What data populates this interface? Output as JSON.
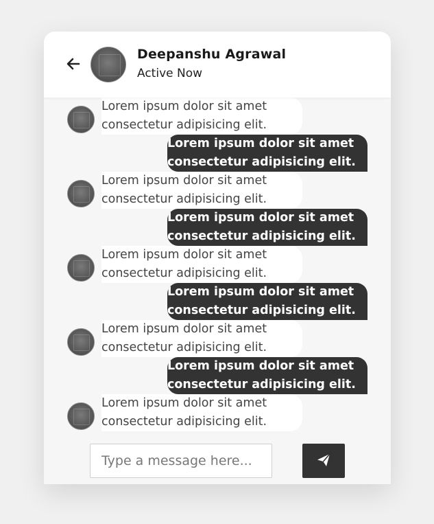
{
  "header": {
    "user_name": "Deepanshu Agrawal",
    "status": "Active Now"
  },
  "messages": [
    {
      "direction": "incoming",
      "lines": [
        "Lorem ipsum dolor sit amet",
        "consectetur adipisicing elit."
      ]
    },
    {
      "direction": "outgoing",
      "lines": [
        "Lorem ipsum dolor sit amet",
        "consectetur adipisicing elit."
      ]
    },
    {
      "direction": "incoming",
      "lines": [
        "Lorem ipsum dolor sit amet",
        "consectetur adipisicing elit."
      ]
    },
    {
      "direction": "outgoing",
      "lines": [
        "Lorem ipsum dolor sit amet",
        "consectetur adipisicing elit."
      ]
    },
    {
      "direction": "incoming",
      "lines": [
        "Lorem ipsum dolor sit amet",
        "consectetur adipisicing elit."
      ]
    },
    {
      "direction": "outgoing",
      "lines": [
        "Lorem ipsum dolor sit amet",
        "consectetur adipisicing elit."
      ]
    },
    {
      "direction": "incoming",
      "lines": [
        "Lorem ipsum dolor sit amet",
        "consectetur adipisicing elit."
      ]
    },
    {
      "direction": "outgoing",
      "lines": [
        "Lorem ipsum dolor sit amet",
        "consectetur adipisicing elit."
      ]
    },
    {
      "direction": "incoming",
      "lines": [
        "Lorem ipsum dolor sit amet",
        "consectetur adipisicing elit."
      ]
    }
  ],
  "footer": {
    "input_value": "",
    "input_placeholder": "Type a message here..."
  },
  "icons": {
    "back": "arrow-left-icon",
    "send": "paper-plane-icon"
  },
  "colors": {
    "outgoing_bubble": "#333333",
    "incoming_bubble": "#ffffff",
    "send_button": "#333333"
  }
}
